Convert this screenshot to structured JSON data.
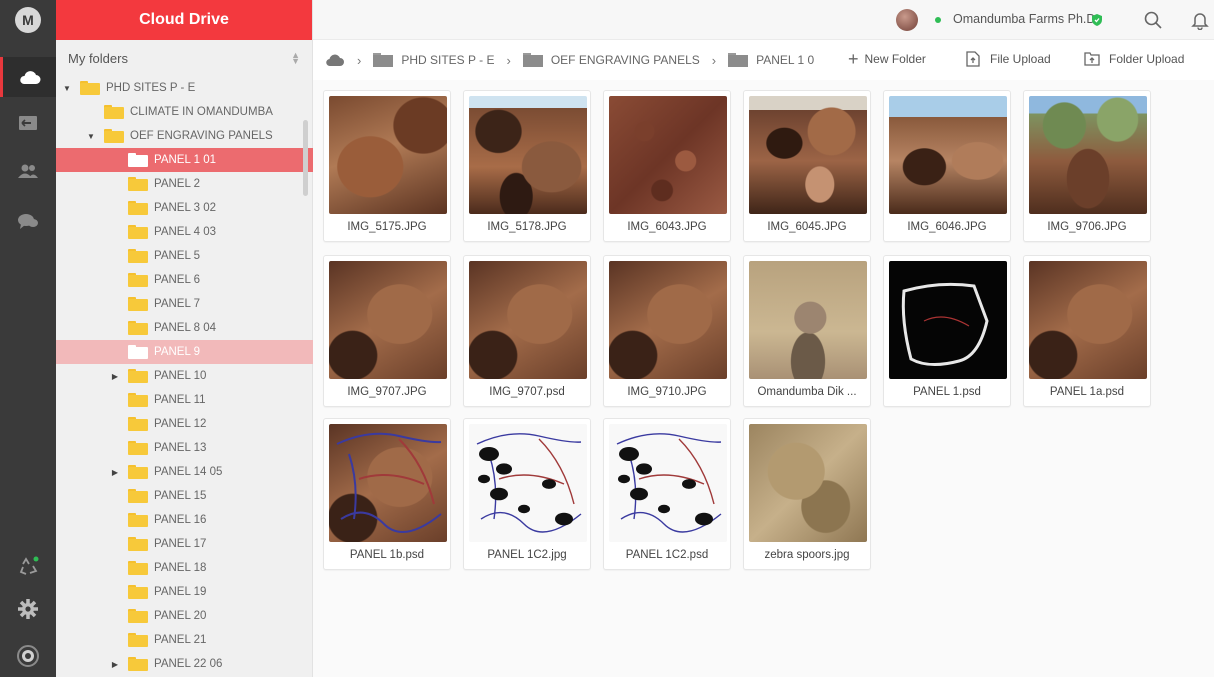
{
  "app": {
    "title": "Cloud Drive",
    "logo_letter": "M"
  },
  "sidebar": {
    "header": "My folders",
    "tree": [
      {
        "label": "PHD SITES P - E",
        "expanded": true,
        "level": 0
      },
      {
        "label": "CLIMATE IN OMANDUMBA",
        "level": 1
      },
      {
        "label": "OEF ENGRAVING PANELS",
        "expanded": true,
        "level": 1
      },
      {
        "label": "PANEL 1 01",
        "level": 2,
        "state": "selected"
      },
      {
        "label": "PANEL 2",
        "level": 2
      },
      {
        "label": "PANEL 3 02",
        "level": 2
      },
      {
        "label": "PANEL 4 03",
        "level": 2
      },
      {
        "label": "PANEL 5",
        "level": 2
      },
      {
        "label": "PANEL 6",
        "level": 2
      },
      {
        "label": "PANEL 7",
        "level": 2
      },
      {
        "label": "PANEL 8 04",
        "level": 2
      },
      {
        "label": "PANEL 9",
        "level": 2,
        "state": "highlighted"
      },
      {
        "label": "PANEL 10",
        "level": 2,
        "expandable": true
      },
      {
        "label": "PANEL 11",
        "level": 2
      },
      {
        "label": "PANEL 12",
        "level": 2
      },
      {
        "label": "PANEL 13",
        "level": 2
      },
      {
        "label": "PANEL 14 05",
        "level": 2,
        "expandable": true
      },
      {
        "label": "PANEL 15",
        "level": 2
      },
      {
        "label": "PANEL 16",
        "level": 2
      },
      {
        "label": "PANEL 17",
        "level": 2
      },
      {
        "label": "PANEL 18",
        "level": 2
      },
      {
        "label": "PANEL 19",
        "level": 2
      },
      {
        "label": "PANEL 20",
        "level": 2
      },
      {
        "label": "PANEL 21",
        "level": 2
      },
      {
        "label": "PANEL 22 06",
        "level": 2,
        "expandable": true
      }
    ]
  },
  "header": {
    "username": "Omandumba Farms Ph.D",
    "status_color": "#2fbd55"
  },
  "breadcrumb": {
    "items": [
      "PHD SITES P - E",
      "OEF ENGRAVING PANELS",
      "PANEL 1 0"
    ],
    "new_folder": "New Folder",
    "file_upload": "File Upload",
    "folder_upload": "Folder Upload"
  },
  "files": [
    {
      "name": "IMG_5175.JPG",
      "thumb": "rock1"
    },
    {
      "name": "IMG_5178.JPG",
      "thumb": "rock2"
    },
    {
      "name": "IMG_6043.JPG",
      "thumb": "rock3"
    },
    {
      "name": "IMG_6045.JPG",
      "thumb": "rock4"
    },
    {
      "name": "IMG_6046.JPG",
      "thumb": "rock5"
    },
    {
      "name": "IMG_9706.JPG",
      "thumb": "bush"
    },
    {
      "name": "IMG_9707.JPG",
      "thumb": "rock6"
    },
    {
      "name": "IMG_9707.psd",
      "thumb": "rock6"
    },
    {
      "name": "IMG_9710.JPG",
      "thumb": "rock6"
    },
    {
      "name": "Omandumba Dik ...",
      "thumb": "dik"
    },
    {
      "name": "PANEL 1.psd",
      "thumb": "black"
    },
    {
      "name": "PANEL 1a.psd",
      "thumb": "rock6"
    },
    {
      "name": "PANEL 1b.psd",
      "thumb": "rock-drawn"
    },
    {
      "name": "PANEL 1C2.jpg",
      "thumb": "tracing"
    },
    {
      "name": "PANEL 1C2.psd",
      "thumb": "tracing"
    },
    {
      "name": "zebra spoors.jpg",
      "thumb": "sand"
    }
  ],
  "colors": {
    "accent": "#f3393e",
    "selected_row": "#ec6b6f",
    "highlighted_row": "#f2b9ba",
    "folder": "#f7c93a"
  }
}
